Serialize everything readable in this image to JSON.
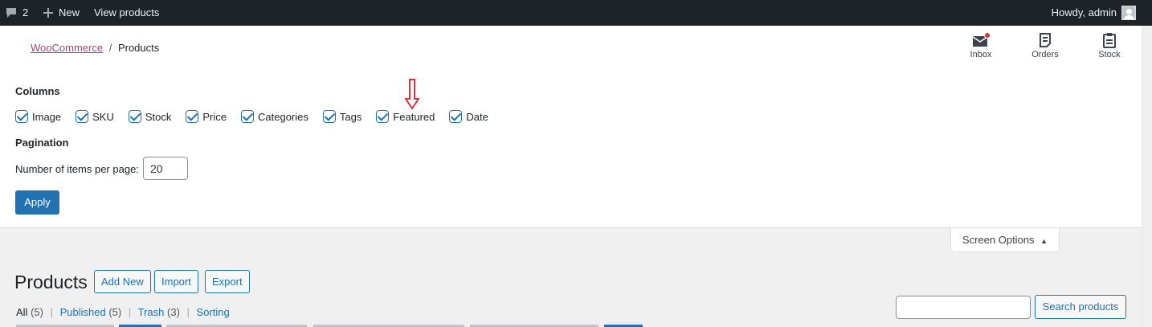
{
  "adminbar": {
    "comments_count": "2",
    "new_label": "New",
    "view_products": "View products",
    "howdy": "Howdy, admin"
  },
  "breadcrumb": {
    "root": "WooCommerce",
    "separator": "/",
    "current": "Products"
  },
  "activity": {
    "inbox": "Inbox",
    "orders": "Orders",
    "stock": "Stock"
  },
  "screen_options": {
    "columns_title": "Columns",
    "columns": [
      {
        "label": "Image",
        "checked": true
      },
      {
        "label": "SKU",
        "checked": true
      },
      {
        "label": "Stock",
        "checked": true
      },
      {
        "label": "Price",
        "checked": true
      },
      {
        "label": "Categories",
        "checked": true
      },
      {
        "label": "Tags",
        "checked": true
      },
      {
        "label": "Featured",
        "checked": true
      },
      {
        "label": "Date",
        "checked": true
      }
    ],
    "pagination_title": "Pagination",
    "per_page_label": "Number of items per page:",
    "per_page_value": "20",
    "apply_label": "Apply",
    "tab_label": "Screen Options"
  },
  "page": {
    "title": "Products",
    "add_new": "Add New",
    "import": "Import",
    "export": "Export"
  },
  "views": {
    "all": "All",
    "all_count": "(5)",
    "published": "Published",
    "published_count": "(5)",
    "trash": "Trash",
    "trash_count": "(3)",
    "sorting": "Sorting",
    "sep": "|"
  },
  "search": {
    "button": "Search products",
    "value": ""
  },
  "colors": {
    "admin_bar": "#1d2327",
    "primary": "#2271b1",
    "woo_link": "#a54573",
    "annotation_arrow": "#d63638",
    "inbox_dot": "#d63638"
  }
}
